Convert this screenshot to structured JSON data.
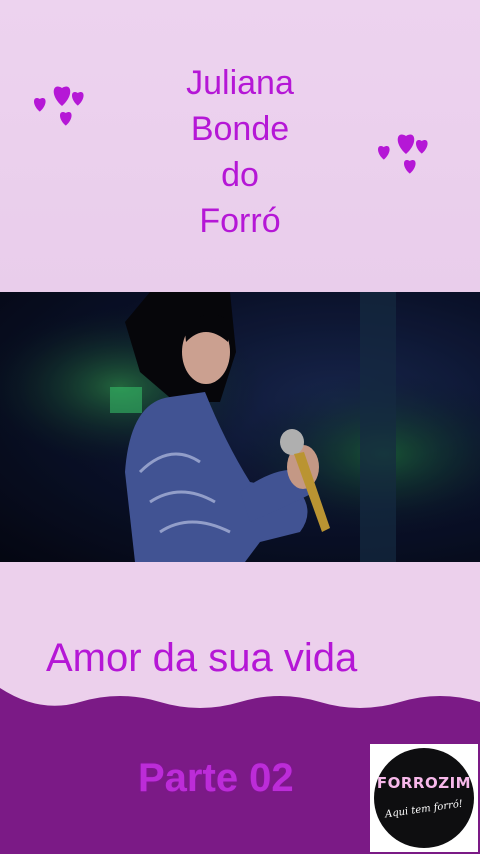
{
  "header": {
    "title_lines": [
      "Juliana",
      "Bonde",
      "do",
      "Forró"
    ]
  },
  "song": {
    "title": "Amor da sua vida"
  },
  "footer": {
    "part_label": "Parte 02",
    "logo": {
      "name": "FORROZIM",
      "tagline": "Aqui tem forró!"
    }
  },
  "colors": {
    "background": "#ecd0ec",
    "accent": "#b517d6",
    "wave": "#7b1a86"
  },
  "icons": [
    "hearts-icon",
    "hearts-icon",
    "microphone-icon"
  ]
}
